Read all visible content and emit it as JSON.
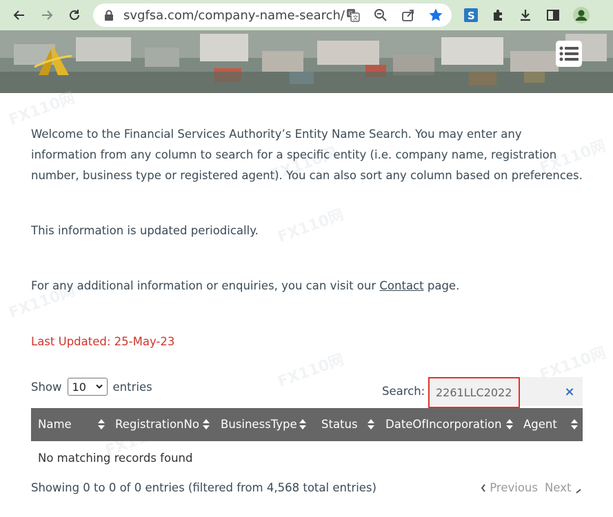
{
  "browser": {
    "url": "svgfsa.com/company-name-search/"
  },
  "content": {
    "intro": "Welcome to the Financial Services Authority’s Entity Name Search. You may enter any information from any column to search for a specific entity (i.e. company name, registration number, business type or registered agent). You can also sort any column based on preferences.",
    "periodic": "This information is updated periodically.",
    "contact_prefix": "For any additional information or enquiries, you can visit our ",
    "contact_link": "Contact",
    "contact_suffix": " page.",
    "last_updated": "Last Updated:  25-May-23"
  },
  "table_controls": {
    "show_label": "Show",
    "entries_value": "10",
    "entries_label": "entries",
    "search_label": "Search:",
    "search_value": "2261LLC2022",
    "clear_symbol": "×"
  },
  "table": {
    "columns": [
      "Name",
      "RegistrationNo",
      "BusinessType",
      "Status",
      "DateOfIncorporation",
      "Agent"
    ],
    "empty_message": "No matching records found",
    "info": "Showing 0 to 0 of 0 entries (filtered from 4,568 total entries)",
    "previous": "Previous",
    "next": "Next"
  },
  "watermark": "FX110网",
  "colors": {
    "toolbar": "#d7e8d3",
    "header_row": "#666666",
    "highlight": "#e2332b",
    "updated_text": "#d0342c",
    "star": "#1a73e8"
  }
}
